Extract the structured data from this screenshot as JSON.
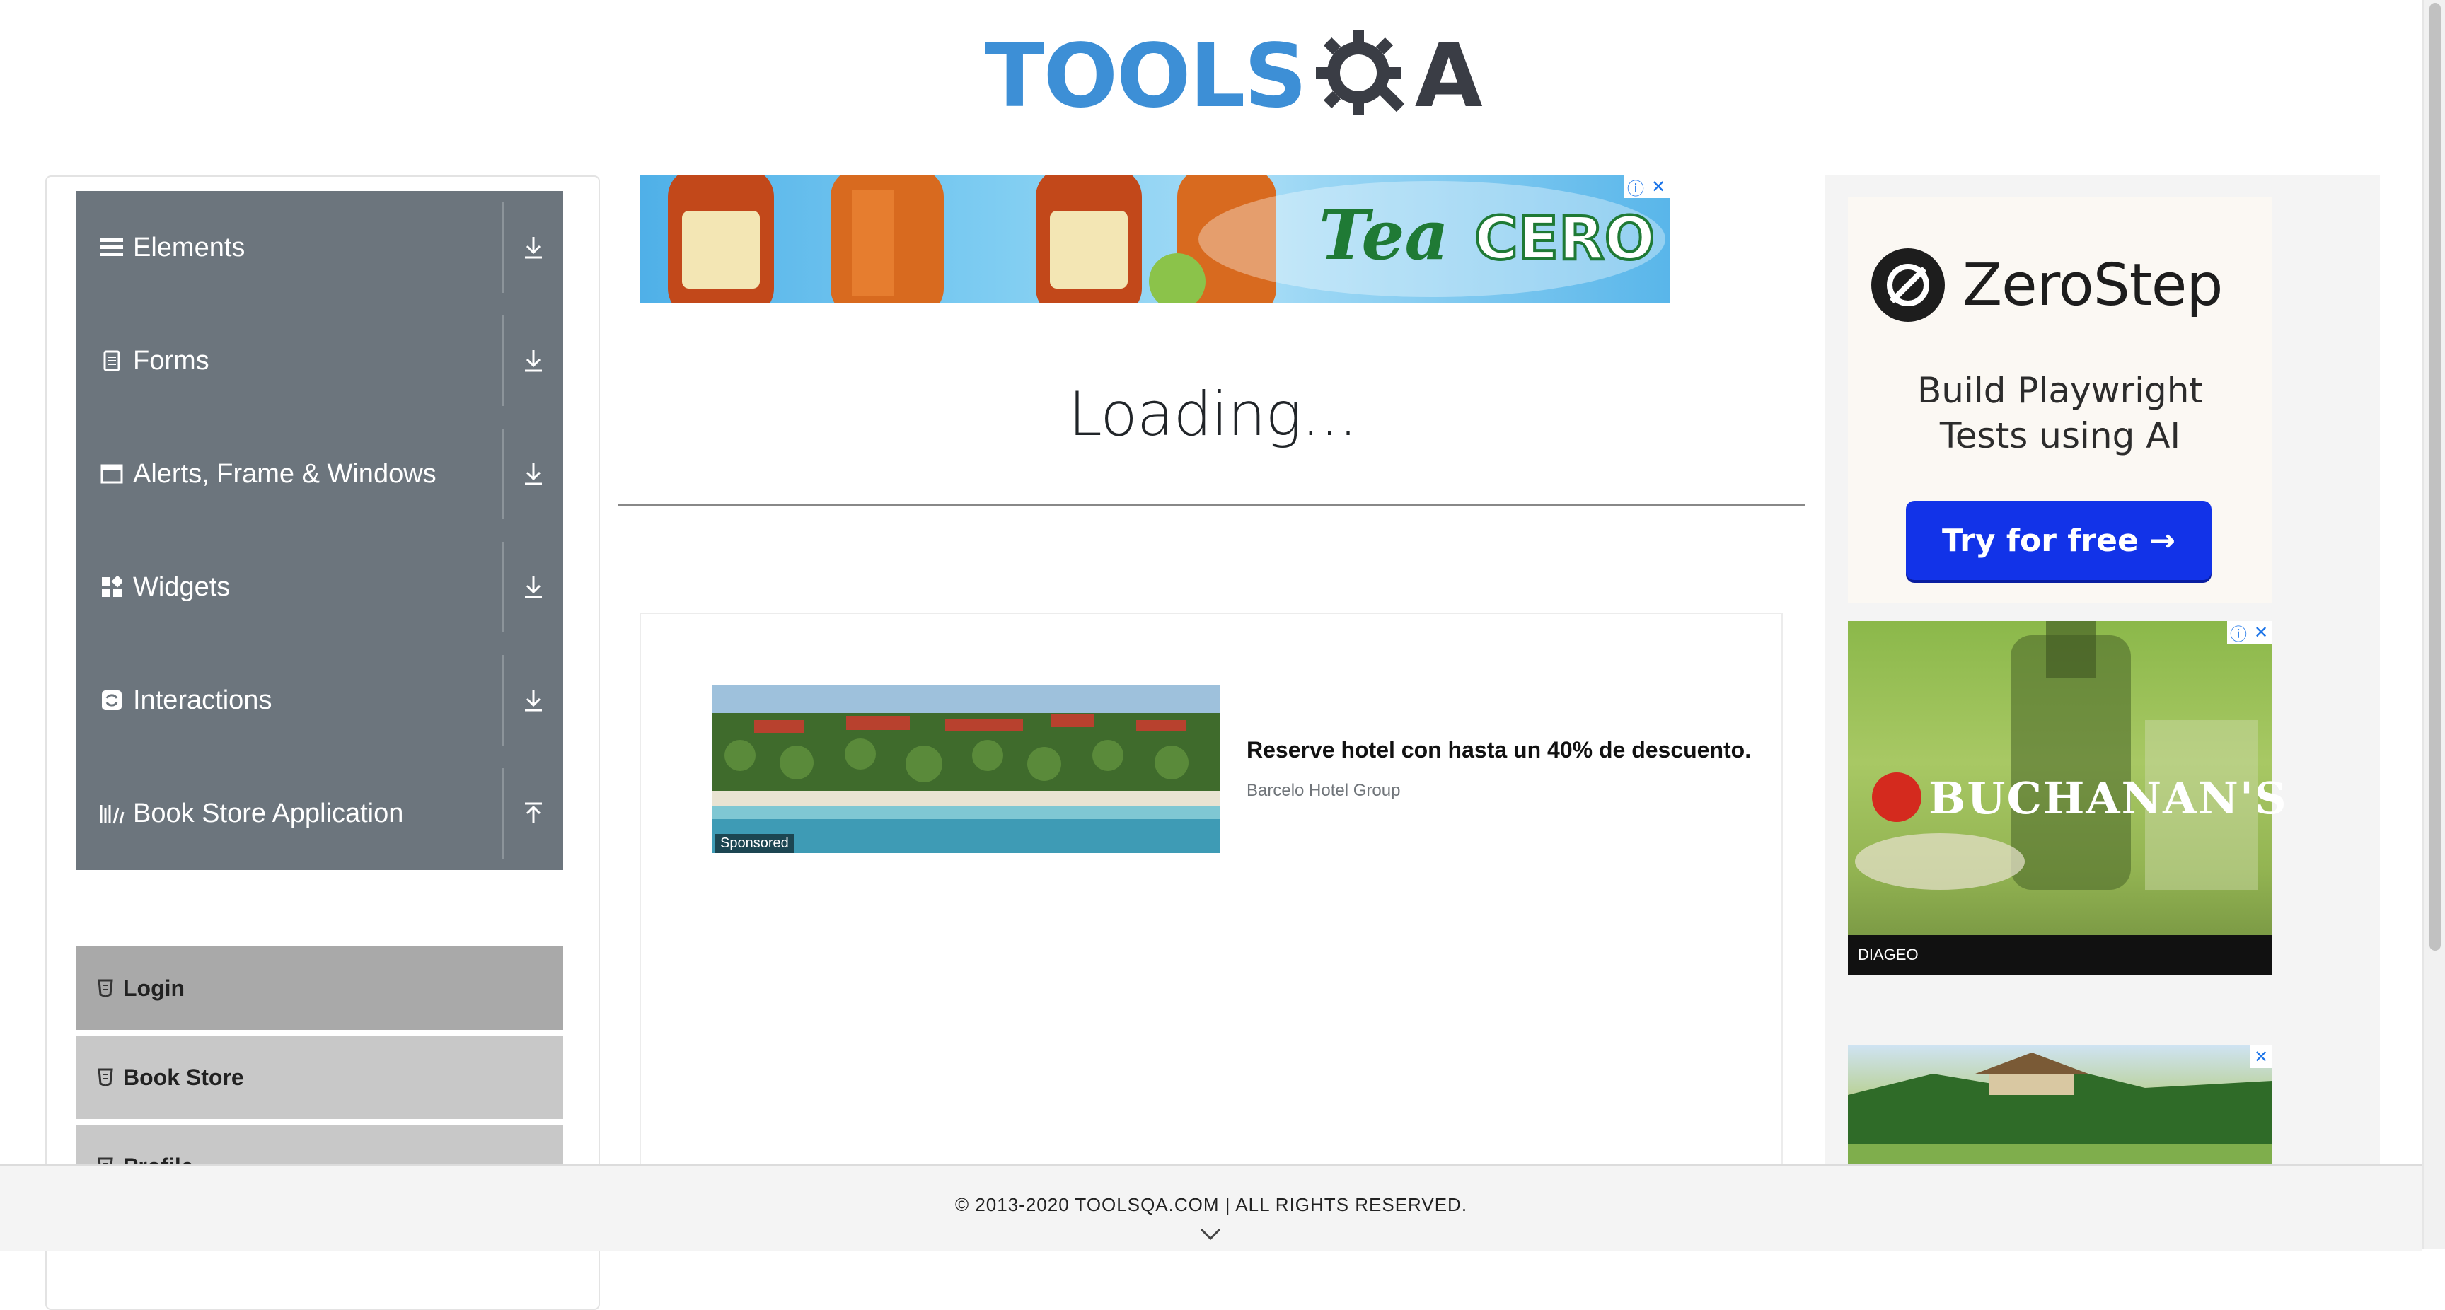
{
  "header": {
    "logo_text": "TOOLS",
    "logo_suffix": "A"
  },
  "sidebar": {
    "groups": [
      {
        "label": "Elements",
        "icon": "hamburger-icon",
        "toggle": "download-icon"
      },
      {
        "label": "Forms",
        "icon": "document-icon",
        "toggle": "download-icon"
      },
      {
        "label": "Alerts, Frame & Windows",
        "icon": "window-icon",
        "toggle": "download-icon"
      },
      {
        "label": "Widgets",
        "icon": "widgets-icon",
        "toggle": "download-icon"
      },
      {
        "label": "Interactions",
        "icon": "interactions-icon",
        "toggle": "download-icon"
      },
      {
        "label": "Book Store Application",
        "icon": "books-icon",
        "toggle": "upload-icon"
      }
    ],
    "subitems": [
      {
        "label": "Login",
        "active": true
      },
      {
        "label": "Book Store",
        "active": false
      },
      {
        "label": "Profile",
        "active": false
      }
    ]
  },
  "main": {
    "loading_text": "Loading..."
  },
  "ads": {
    "banner": {
      "brand": "Mr. Tea CERO"
    },
    "sponsored": {
      "tag": "Sponsored",
      "title": "Reserve hotel con hasta un 40% de descuento.",
      "advertiser": "Barcelo Hotel Group"
    },
    "zerostep": {
      "brand": "ZeroStep",
      "headline_line1": "Build Playwright",
      "headline_line2": "Tests using AI",
      "cta": "Try for free →"
    },
    "buchanans": {
      "brand": "BUCHANAN'S",
      "footer": "DIAGEO"
    }
  },
  "footer": {
    "copyright": "© 2013-2020 TOOLSQA.COM | ALL RIGHTS RESERVED."
  },
  "colors": {
    "sidebar_group": "#6c757d",
    "subitem": "#c8c8c8",
    "subitem_active": "#a9a9a9",
    "logo_blue": "#3d8fd6",
    "cta_blue": "#1233e8"
  }
}
